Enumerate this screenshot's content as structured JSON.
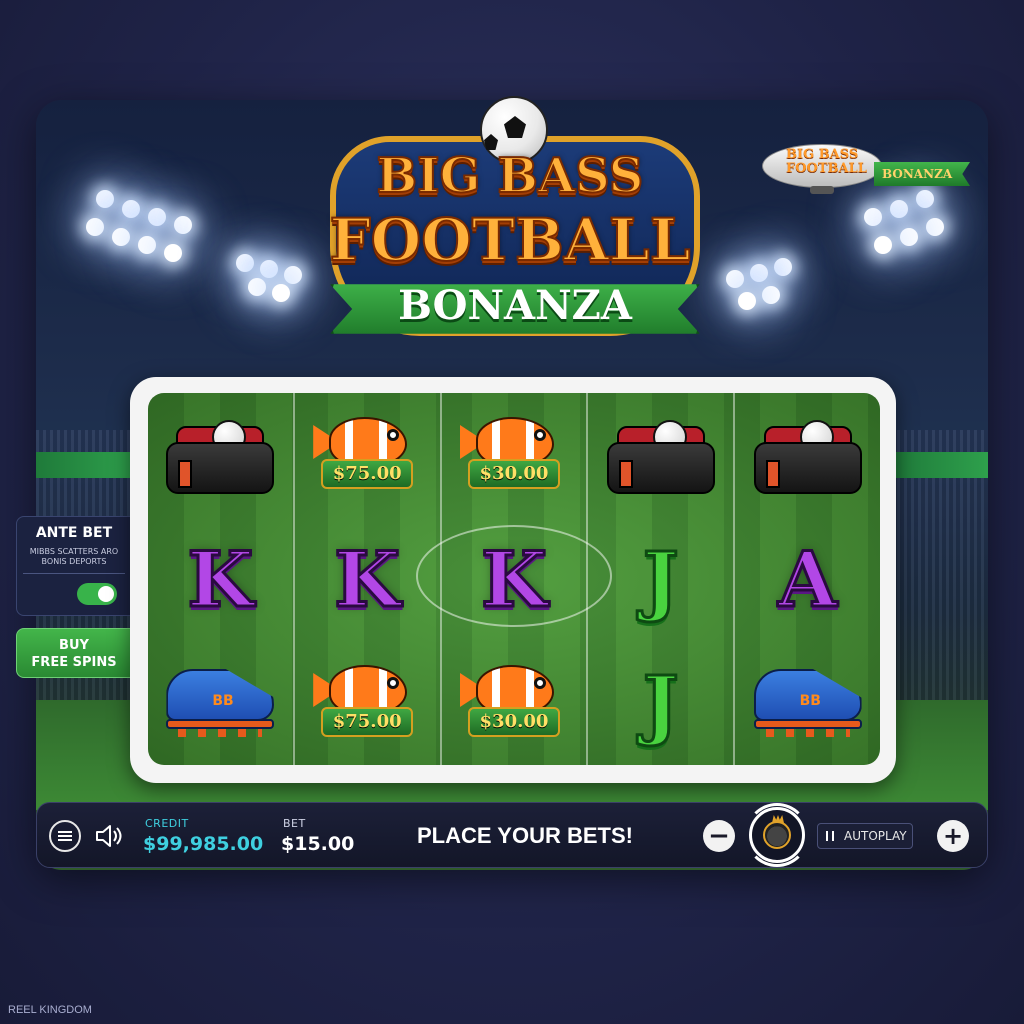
{
  "logo": {
    "line1": "BIG BASS",
    "line2": "FOOTBALL",
    "line3": "BONANZA"
  },
  "blimp": {
    "text": "BIG BASS FOOTBALL",
    "banner": "BONANZA"
  },
  "ante_bet": {
    "title": "ANTE BET",
    "subtitle": "MIBBS SCATTERS ARO BONIS DEPORTS",
    "enabled": true
  },
  "buy_free_spins": {
    "label_line1": "BUY",
    "label_line2": "FREE SPINS"
  },
  "reels": [
    [
      {
        "symbol": "bag"
      },
      {
        "symbol": "letter",
        "text": "K",
        "color": "#b247e6"
      },
      {
        "symbol": "boot",
        "text": "BB"
      }
    ],
    [
      {
        "symbol": "fish",
        "value": "$75.00"
      },
      {
        "symbol": "letter",
        "text": "K",
        "color": "#b247e6"
      },
      {
        "symbol": "fish",
        "value": "$75.00"
      }
    ],
    [
      {
        "symbol": "fish",
        "value": "$30.00"
      },
      {
        "symbol": "letter",
        "text": "K",
        "color": "#b247e6"
      },
      {
        "symbol": "fish",
        "value": "$30.00"
      }
    ],
    [
      {
        "symbol": "bag"
      },
      {
        "symbol": "letter",
        "text": "J",
        "color": "#49d33f"
      },
      {
        "symbol": "letter",
        "text": "J",
        "color": "#49d33f"
      }
    ],
    [
      {
        "symbol": "bag"
      },
      {
        "symbol": "letter",
        "text": "A",
        "color": "#b247e6"
      },
      {
        "symbol": "boot",
        "text": "BB"
      }
    ]
  ],
  "bottom_bar": {
    "credit_label": "CREDIT",
    "credit_value": "$99,985.00",
    "bet_label": "BET",
    "bet_value": "$15.00",
    "status": "PLACE YOUR BETS!",
    "minus_label": "−",
    "plus_label": "+",
    "autoplay_label": "AUTOPLAY",
    "menu_icon": "menu-icon",
    "sound_icon": "sound-icon",
    "spin_icon": "spin-icon"
  },
  "brand": "REEL KINGDOM",
  "colors": {
    "credit": "#3fd0e0",
    "buy_button": "#43b54a",
    "toggle_on": "#38b34a",
    "logo_orange": "#ffb13b",
    "ribbon_green": "#2ea04c"
  }
}
